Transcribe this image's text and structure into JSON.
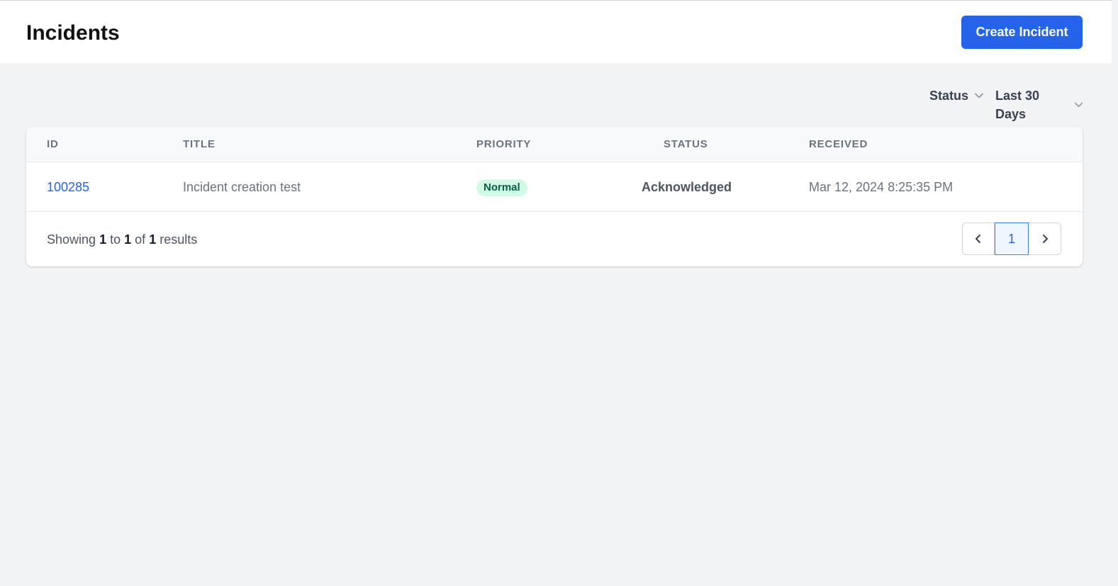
{
  "header": {
    "title": "Incidents",
    "create_label": "Create Incident"
  },
  "filters": {
    "status_label": "Status",
    "range_label": "Last 30 Days"
  },
  "table": {
    "columns": [
      "ID",
      "TITLE",
      "PRIORITY",
      "STATUS",
      "RECEIVED"
    ],
    "rows": [
      {
        "id": "100285",
        "title": "Incident creation test",
        "priority": "Normal",
        "status": "Acknowledged",
        "received": "Mar 12, 2024 8:25:35 PM"
      }
    ]
  },
  "pagination": {
    "showing_prefix": "Showing",
    "from": "1",
    "to_word": "to",
    "to": "1",
    "of_word": "of",
    "total": "1",
    "results_word": "results",
    "current_page": "1"
  },
  "colors": {
    "primary": "#2563eb",
    "badge_bg": "#d1fae5",
    "badge_text": "#065f46",
    "background": "#f2f3f5"
  },
  "icons": {
    "dropdown": "chevron-down-icon",
    "prev": "chevron-left-icon",
    "next": "chevron-right-icon"
  }
}
